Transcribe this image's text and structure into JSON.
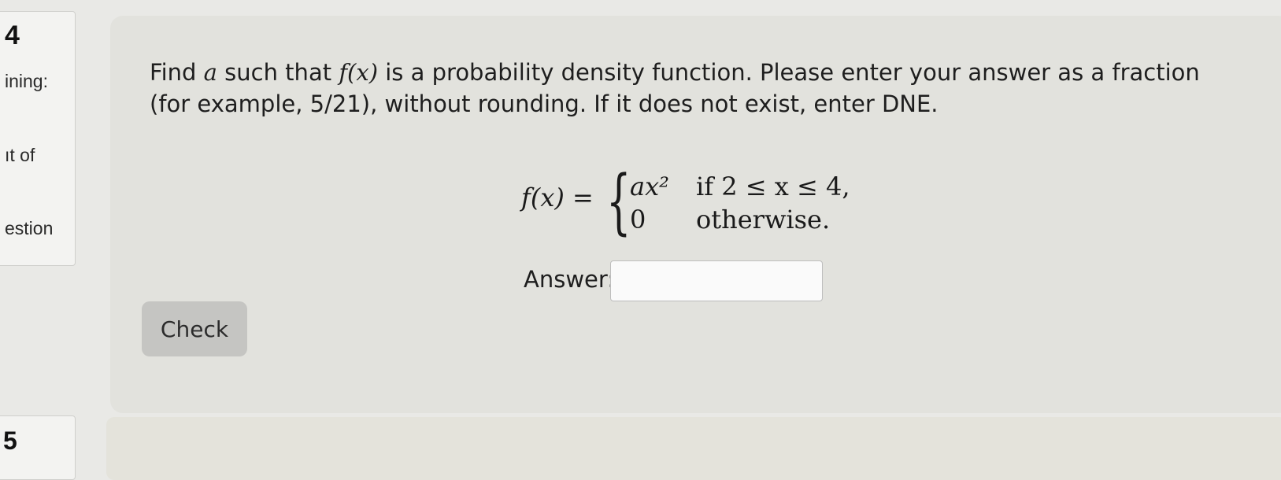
{
  "sidebar": {
    "question_number": "4",
    "label_remaining": "ining:",
    "label_out_of": "ıt of",
    "label_question": "estion",
    "next_question_number": "5"
  },
  "question": {
    "text_1": "Find ",
    "var_a": "a",
    "text_2": " such that ",
    "func": "f(x)",
    "text_3": " is a probability density function. Please enter your answer as a fraction (for example, 5/21), without rounding. If it does not exist, enter DNE."
  },
  "formula": {
    "lhs": "f(x) =",
    "brace": "{",
    "case1_expr": "ax²",
    "case1_cond": "if 2 ≤ x ≤ 4,",
    "case2_expr": "0",
    "case2_cond": "otherwise."
  },
  "answer": {
    "label": "Answer:",
    "value": "",
    "placeholder": ""
  },
  "check_button": {
    "label": "Check"
  }
}
